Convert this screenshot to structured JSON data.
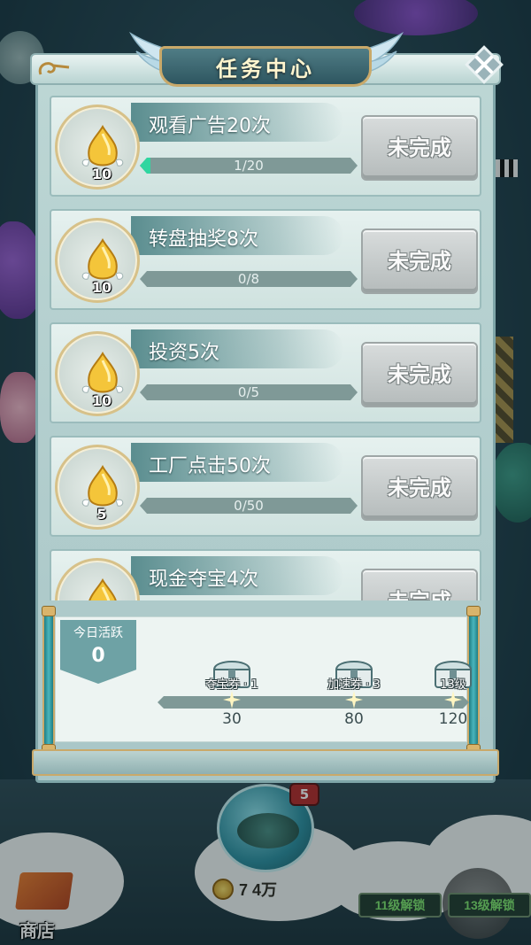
{
  "panel": {
    "title": "任务中心"
  },
  "tasks": [
    {
      "name": "观看广告20次",
      "reward": "10",
      "progress_text": "1/20",
      "progress": 0.05,
      "status": "未完成"
    },
    {
      "name": "转盘抽奖8次",
      "reward": "10",
      "progress_text": "0/8",
      "progress": 0,
      "status": "未完成"
    },
    {
      "name": "投资5次",
      "reward": "10",
      "progress_text": "0/5",
      "progress": 0,
      "status": "未完成"
    },
    {
      "name": "工厂点击50次",
      "reward": "5",
      "progress_text": "0/50",
      "progress": 0,
      "status": "未完成"
    },
    {
      "name": "现金夺宝4次",
      "reward": "",
      "progress_text": "",
      "progress": 0,
      "status": "未完成"
    }
  ],
  "activity": {
    "label": "今日活跃",
    "value": "0",
    "milestones": [
      {
        "label": "夺宝券 · 1",
        "value": "30"
      },
      {
        "label": "加速券 · 3",
        "value": "80"
      },
      {
        "label": "13级",
        "value": "120"
      }
    ]
  },
  "game": {
    "pending_count": "5",
    "coin_amount": "7 4万",
    "unlock_buttons": [
      "11级解锁",
      "13级解锁"
    ],
    "shop_label": "商店"
  },
  "colors": {
    "progress_fill": "#2fd6a0",
    "panel_bg": "#bcd6d4",
    "gold_trim": "#c9a96a"
  }
}
